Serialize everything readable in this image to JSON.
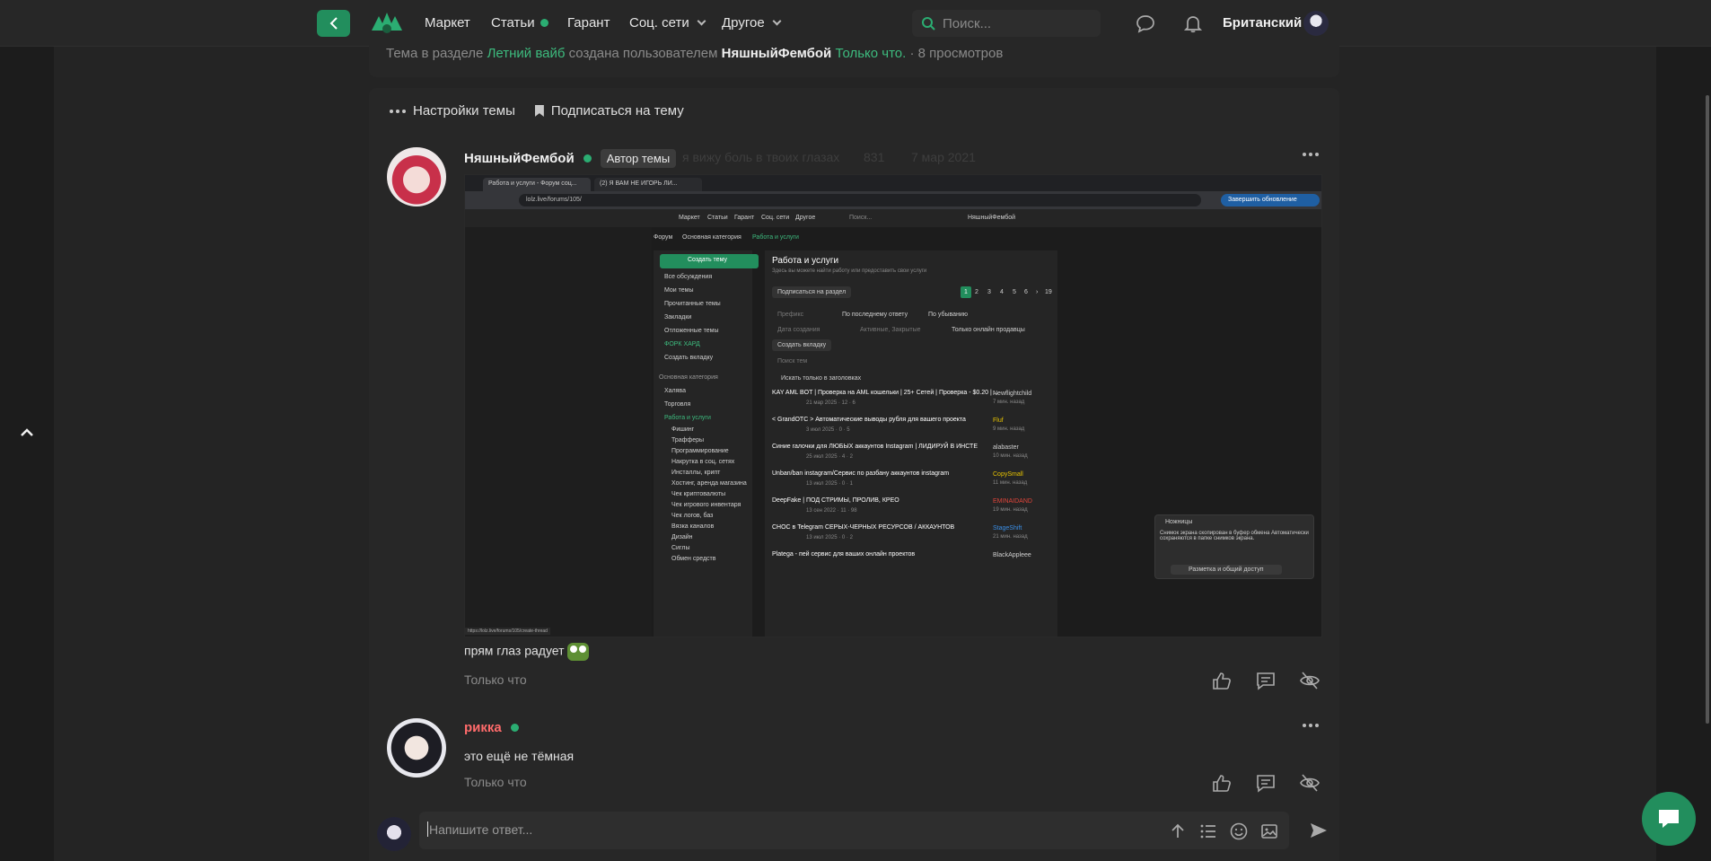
{
  "nav": {
    "items": [
      {
        "label": "Маркет"
      },
      {
        "label": "Статьи"
      },
      {
        "label": "Гарант"
      },
      {
        "label": "Соц. сети"
      },
      {
        "label": "Другое"
      }
    ],
    "search_placeholder": "Поиск...",
    "username": "Британский"
  },
  "topic_info": {
    "prefix": "Тема в разделе",
    "section": "Летний вайб",
    "created_by": "создана пользователем",
    "author": "НяшныйФембой",
    "time": "Только что.",
    "views": "· 8 просмотров"
  },
  "thread_actions": {
    "settings": "Настройки темы",
    "subscribe": "Подписаться на тему"
  },
  "posts": [
    {
      "author": "НяшныйФембой",
      "badge": "Автор темы",
      "faded_status": "я вижу боль в твоих глазах",
      "faded_likes": "831",
      "faded_date": "7 мар 2021",
      "text": "прям глаз радует",
      "time": "Только что",
      "author_color": "#f0f0f0"
    },
    {
      "author": "рикка",
      "text": "это ещё не тёмная",
      "time": "Только что",
      "author_color": "#ff6b6b"
    }
  ],
  "reply": {
    "placeholder": "Напишите ответ..."
  },
  "screenshot": {
    "tab1": "Работа и услуги - Форум соц...",
    "tab2": "(2) Я ВАМ НЕ ИГОРЬ ЛИ...",
    "url": "lolz.live/forums/105/",
    "update_btn": "Завершить обновление",
    "nav_items": [
      "Маркет",
      "Статьи",
      "Гарант",
      "Соц. сети",
      "Другое"
    ],
    "search": "Поиск...",
    "user": "НяшныйФембой",
    "breadcrumb": [
      "Форум",
      "Основная категория",
      "Работа и услуги"
    ],
    "create_btn": "Создать тему",
    "side_items": [
      "Все обсуждения",
      "Мои темы",
      "Прочитанные темы",
      "Закладки",
      "Отложенные темы",
      "ФОРК ХАРД",
      "Создать вкладку"
    ],
    "side_category": "Основная категория",
    "side_cat_items": [
      "Халява",
      "Торговля",
      "Работа и услуги"
    ],
    "side_sub_items": [
      "Фишинг",
      "Трафферы",
      "Программирование",
      "Накрутка в соц. сетях",
      "Инсталлы, крипт",
      "Хостинг, аренда магазина",
      "Чек криптовалюты",
      "Чек игрового инвентаря",
      "Чек логов, баз",
      "Вязка каналов",
      "Дизайн",
      "Сиглы",
      "Обмен средств"
    ],
    "main_title": "Работа и услуги",
    "main_sub": "Здесь вы можете найти работу или предоставить свои услуги",
    "subscribe_btn": "Подписаться на раздел",
    "pages": [
      "1",
      "2",
      "3",
      "4",
      "5",
      "6",
      "›",
      "19"
    ],
    "filters": [
      "Префикс",
      "По последнему ответу",
      "По убыванию",
      "Дата создания",
      "Активные, Закрытые",
      "Только онлайн продавцы"
    ],
    "create_tab": "Создать вкладку",
    "search_topics": "Поиск тем",
    "only_titles": "Искать только в заголовках",
    "threads": [
      {
        "title": "KAY AML BOT | Проверка на AML кошельки | 25+ Сетей | Проверка - $0.20 | ...",
        "meta": "21 мар 2025 · 12 · 6",
        "user": "Newflightchild",
        "ago": "7 мин. назад"
      },
      {
        "title": "< GrandOTC > Автоматические выводы рубля для вашего проекта",
        "meta": "3 июл 2025 · 0 · 5",
        "user": "Fluf",
        "ago": "9 мин. назад"
      },
      {
        "title": "Синие галочки для ЛЮБЫХ аккаунтов Instagram | ЛИДИРУЙ В ИНСТЕ",
        "meta": "25 июл 2025 · 4 · 2",
        "user": "alabaster",
        "ago": "10 мин. назад"
      },
      {
        "title": "Unban/ban instagram/Сервис по разбану аккаунтов instagram",
        "meta": "13 июл 2025 · 0 · 1",
        "user": "CopySmall",
        "ago": "11 мин. назад"
      },
      {
        "title": "DeepFake | ПОД СТРИМЫ, ПРОЛИВ, КРЕО",
        "meta": "13 сен 2022 · 11 · 98",
        "user": "EMINAIDAND",
        "ago": "19 мин. назад"
      },
      {
        "title": "СНОС в Telegram СЕРЫХ-ЧЕРНЫХ РЕСУРСОВ / АККАУНТОВ",
        "meta": "13 июл 2025 · 0 · 2",
        "user": "StageShift",
        "ago": "21 мин. назад"
      },
      {
        "title": "Plategа - пей сервис для ваших онлайн проектов",
        "meta": "",
        "user": "BlackAppleee",
        "ago": ""
      }
    ],
    "popup_title": "Ножницы",
    "popup_text": "Снимок экрана скопирован в буфер обмена Автоматически сохраняются в папке снимков экрана.",
    "popup_btn": "Разметка и общий доступ",
    "status_url": "https://lolz.live/forums/105/create-thread"
  },
  "colors": {
    "accent": "#228e5d",
    "link_green": "#3dbb7e",
    "background": "#242424",
    "panel": "#272727"
  }
}
